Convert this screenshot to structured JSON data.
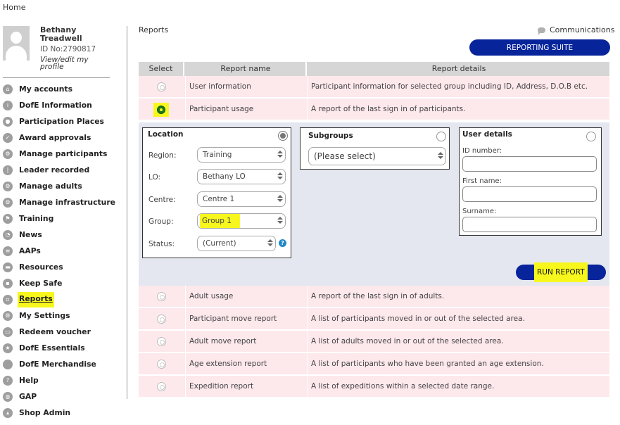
{
  "breadcrumb_top": "Home",
  "profile": {
    "name": "Bethany Treadwell",
    "id": "ID No:2790817",
    "edit_link": "View/edit my profile"
  },
  "sidebar": {
    "items": [
      {
        "label": "My accounts",
        "icon": "home-icon"
      },
      {
        "label": "DofE Information",
        "icon": "info-icon"
      },
      {
        "label": "Participation Places",
        "icon": "person-icon"
      },
      {
        "label": "Award approvals",
        "icon": "check-icon"
      },
      {
        "label": "Manage participants",
        "icon": "gear-icon"
      },
      {
        "label": "Leader recorded",
        "icon": "microphone-icon"
      },
      {
        "label": "Manage adults",
        "icon": "gear-icon"
      },
      {
        "label": "Manage infrastructure",
        "icon": "gear-icon"
      },
      {
        "label": "Training",
        "icon": "flag-icon"
      },
      {
        "label": "News",
        "icon": "clock-icon"
      },
      {
        "label": "AAPs",
        "icon": "list-icon"
      },
      {
        "label": "Resources",
        "icon": "folder-icon"
      },
      {
        "label": "Keep Safe",
        "icon": "lock-icon"
      },
      {
        "label": "Reports",
        "icon": "document-icon",
        "active": true
      },
      {
        "label": "My Settings",
        "icon": "gear-icon"
      },
      {
        "label": "Redeem voucher",
        "icon": "ticket-icon"
      },
      {
        "label": "DofE Essentials",
        "icon": "star-icon"
      },
      {
        "label": "DofE Merchandise",
        "icon": "circle-icon"
      },
      {
        "label": "Help",
        "icon": "question-icon"
      },
      {
        "label": "GAP",
        "icon": "globe-icon"
      },
      {
        "label": "Shop Admin",
        "icon": "shop-icon"
      }
    ]
  },
  "main": {
    "crumb": "Reports",
    "communications": "Communications",
    "reporting_suite": "REPORTING SUITE",
    "table": {
      "headers": [
        "Select",
        "Report name",
        "Report details"
      ],
      "top_rows": [
        {
          "name": "User information",
          "detail": "Participant information for selected group including ID, Address, D.O.B etc."
        },
        {
          "name": "Participant usage",
          "detail": "A report of the last sign in of participants.",
          "selected": true
        }
      ],
      "bottom_rows": [
        {
          "name": "Adult usage",
          "detail": "A report of the last sign in of adults."
        },
        {
          "name": "Participant move report",
          "detail": "A list of participants moved in or out of the selected area."
        },
        {
          "name": "Adult move report",
          "detail": "A list of adults moved in or out of the selected area."
        },
        {
          "name": "Age extension report",
          "detail": "A list of participants who have been granted an age extension."
        },
        {
          "name": "Expedition report",
          "detail": "A list of expeditions within a selected date range."
        }
      ]
    },
    "location": {
      "title": "Location",
      "fields": [
        {
          "label": "Region:",
          "value": "Training"
        },
        {
          "label": "LO:",
          "value": "Bethany LO"
        },
        {
          "label": "Centre:",
          "value": "Centre 1"
        },
        {
          "label": "Group:",
          "value": "Group 1"
        },
        {
          "label": "Status:",
          "value": "(Current)"
        }
      ]
    },
    "subgroups": {
      "title": "Subgroups",
      "value": "(Please select)"
    },
    "user_details": {
      "title": "User details",
      "fields": [
        "ID number:",
        "First name:",
        "Surname:"
      ]
    },
    "run_report": "RUN REPORT"
  }
}
